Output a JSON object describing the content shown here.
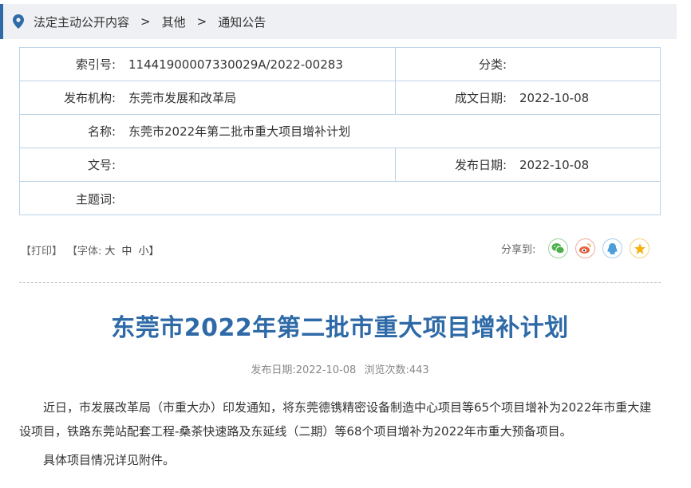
{
  "breadcrumb": {
    "items": [
      "法定主动公开内容",
      "其他",
      "通知公告"
    ],
    "separator": ">"
  },
  "meta": {
    "index_label": "索引号:",
    "index_value": "11441900007330029A/2022-00283",
    "category_label": "分类:",
    "category_value": "",
    "publisher_label": "发布机构:",
    "publisher_value": "东莞市发展和改革局",
    "written_date_label": "成文日期:",
    "written_date_value": "2022-10-08",
    "name_label": "名称:",
    "name_value": "东莞市2022年第二批市重大项目增补计划",
    "doc_no_label": "文号:",
    "doc_no_value": "",
    "release_date_label": "发布日期:",
    "release_date_value": "2022-10-08",
    "subject_label": "主题词:",
    "subject_value": ""
  },
  "tools": {
    "print": "【打印】",
    "font_open": "【字体:",
    "font_large": "大",
    "font_medium": "中",
    "font_small": "小】",
    "share_label": "分享到:",
    "share_icons": [
      "wechat-icon",
      "weibo-icon",
      "qq-icon",
      "qzone-icon"
    ],
    "share_colors": [
      "#4cb04a",
      "#e8603c",
      "#4d9fdc",
      "#f3b30c"
    ]
  },
  "article": {
    "title": "东莞市2022年第二批市重大项目增补计划",
    "pub_date": "发布日期:2022-10-08",
    "views": "浏览次数:443",
    "para1": "近日，市发展改革局（市重大办）印发通知，将东莞德镌精密设备制造中心项目等65个项目增补为2022年市重大建设项目，铁路东莞站配套工程-桑茶快速路及东延线（二期）等68个项目增补为2022年市重大预备项目。",
    "para2": "具体项目情况详见附件。"
  },
  "colors": {
    "accent": "#2e6aa7",
    "table_border": "#bcd3e6",
    "breadcrumb_bg": "#eef0f3"
  }
}
